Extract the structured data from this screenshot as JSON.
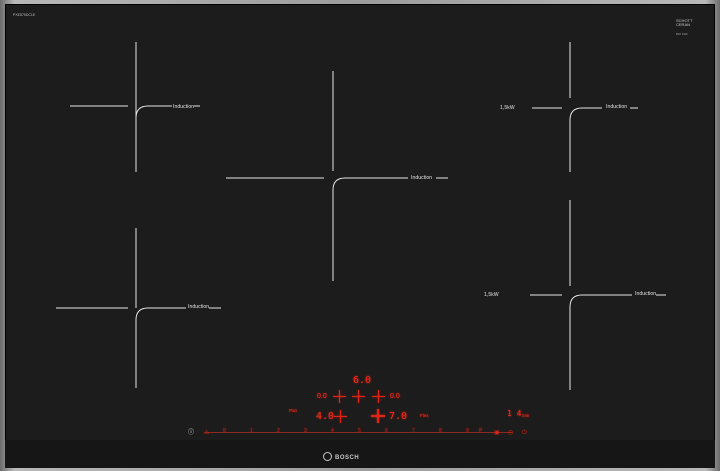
{
  "appliance": {
    "model_code": "PXE875DC1E",
    "glass_brand_line1": "SCHOTT",
    "glass_brand_line2": "CERAN",
    "glass_brand_small": "BSH 0428",
    "brand": "BOSCH"
  },
  "zones": {
    "front_left": {
      "label": "Induction"
    },
    "rear_left": {
      "label": "Induction"
    },
    "center": {
      "label": "Induction"
    },
    "rear_right": {
      "label": "Induction",
      "side_label": "1,5kW"
    },
    "front_right": {
      "label": "Induction",
      "side_label": "1,5kW"
    }
  },
  "control_panel": {
    "top_display": "6.0",
    "top_left_dashes": "0.0",
    "top_right_dashes": "0.0",
    "left_display": "4.0",
    "left_label": "Pan",
    "left_dashes": "0.0",
    "center_display": "7.0",
    "center_label": "Flex",
    "timer_display": "1 4",
    "timer_unit": "min"
  },
  "power_scale": {
    "positions": [
      "0",
      "1",
      "2",
      "3",
      "4",
      "5",
      "6",
      "7",
      "8",
      "9"
    ],
    "boost_label": "P"
  },
  "icons": [
    "info-icon",
    "childlock-icon",
    "boost-icon",
    "pan-icon",
    "timer-icon",
    "power-icon"
  ],
  "colors": {
    "glass": "#1c1c1c",
    "display_red": "#ff2a1a",
    "frame": "#9c9c9c",
    "line": "#e6e6e6"
  }
}
